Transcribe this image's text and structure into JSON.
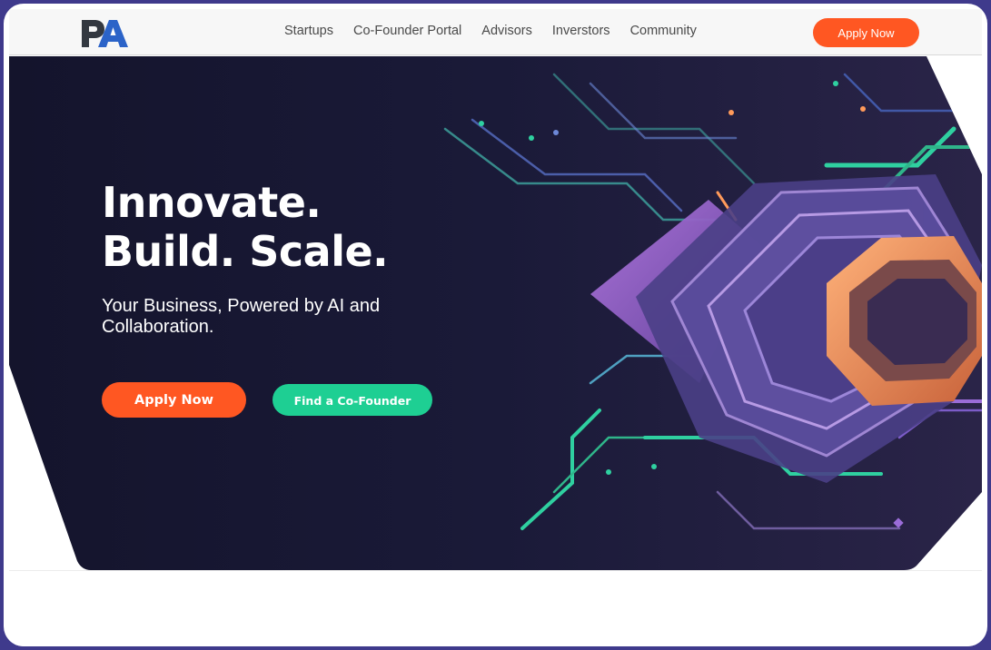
{
  "brand": {
    "logo_text": "PA",
    "colors": {
      "dark": "#333840",
      "accent": "#2b63c8"
    }
  },
  "nav": {
    "links": [
      "Startups",
      "Co-Founder Portal",
      "Advisors",
      "Inverstors",
      "Community"
    ],
    "apply_label": "Apply Now"
  },
  "hero": {
    "title_line1": "Innovate.",
    "title_line2": "Build. Scale.",
    "subtitle": "Your Business, Powered by AI and Collaboration.",
    "primary_cta": "Apply Now",
    "secondary_cta": "Find a Co-Founder",
    "background_color": "#161630",
    "illustration": "circuit-hexagon-art"
  },
  "colors": {
    "primary": "#ff5722",
    "secondary": "#1ecf93",
    "frame": "#3f3a8c"
  }
}
